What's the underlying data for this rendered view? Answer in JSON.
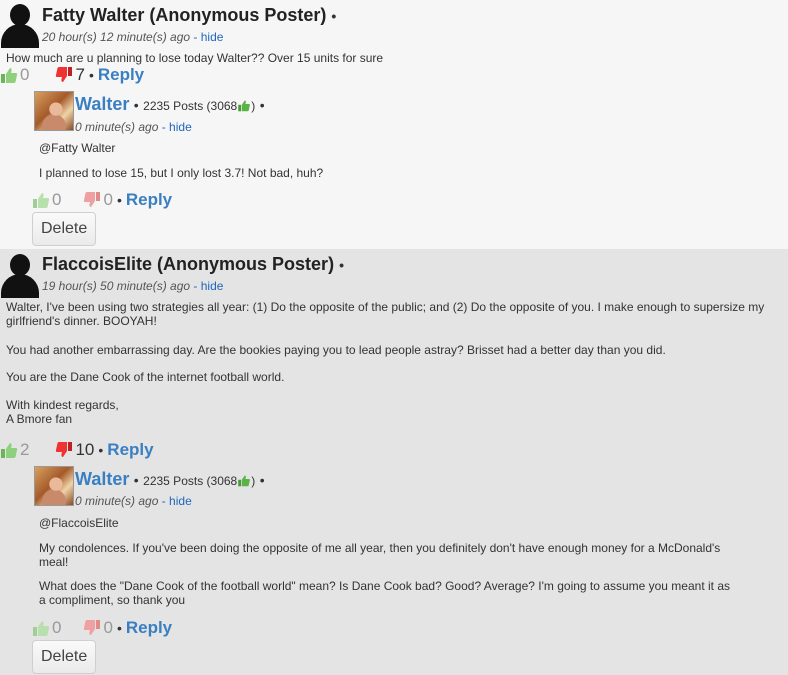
{
  "comments": [
    {
      "author": "Fatty Walter (Anonymous Poster)",
      "time": "20 hour(s) 12 minute(s) ago",
      "hide": "- hide",
      "body": [
        "How much are u planning to lose today Walter?? Over 15 units for sure"
      ],
      "up": "0",
      "down": "7",
      "reply": "Reply",
      "reply_item": {
        "author": "Walter",
        "posts": "2235 Posts (3068",
        "posts_close": ")",
        "time": "0 minute(s) ago",
        "hide": "- hide",
        "body": [
          "@Fatty Walter",
          "I planned to lose 15, but I only lost 3.7! Not bad, huh?"
        ],
        "up": "0",
        "down": "0",
        "reply": "Reply",
        "delete": "Delete"
      }
    },
    {
      "author": "FlaccoisElite (Anonymous Poster)",
      "time": "19 hour(s) 50 minute(s) ago",
      "hide": "- hide",
      "body": [
        "Walter, I've been using two strategies all year: (1) Do the opposite of the public; and (2) Do the opposite of you. I make enough to supersize my girlfriend's dinner. BOOYAH!",
        "You had another embarrassing day. Are the bookies paying you to lead people astray? Brisset had a better day than you did.",
        "You are the Dane Cook of the internet football world.",
        "With kindest regards,",
        "A Bmore fan"
      ],
      "up": "2",
      "down": "10",
      "reply": "Reply",
      "reply_item": {
        "author": "Walter",
        "posts": "2235 Posts (3068",
        "posts_close": ")",
        "time": "0 minute(s) ago",
        "hide": "- hide",
        "body": [
          "@FlaccoisElite",
          "My condolences. If you've been doing the opposite of me all year, then you definitely don't have enough money for a McDonald's meal!",
          "What does the \"Dane Cook of the football world\" mean? Is Dane Cook bad? Good? Average? I'm going to assume you meant it as a compliment, so thank you"
        ],
        "up": "0",
        "down": "0",
        "reply": "Reply",
        "delete": "Delete"
      }
    }
  ],
  "separator": "•",
  "icons": {
    "up": "thumbs-up-icon",
    "down": "thumbs-down-icon",
    "avatar_anon": "anonymous-avatar",
    "avatar_user": "user-avatar-photo"
  },
  "colors": {
    "up": "#7cc36a",
    "down": "#e03030",
    "link": "#3a7fc1"
  }
}
